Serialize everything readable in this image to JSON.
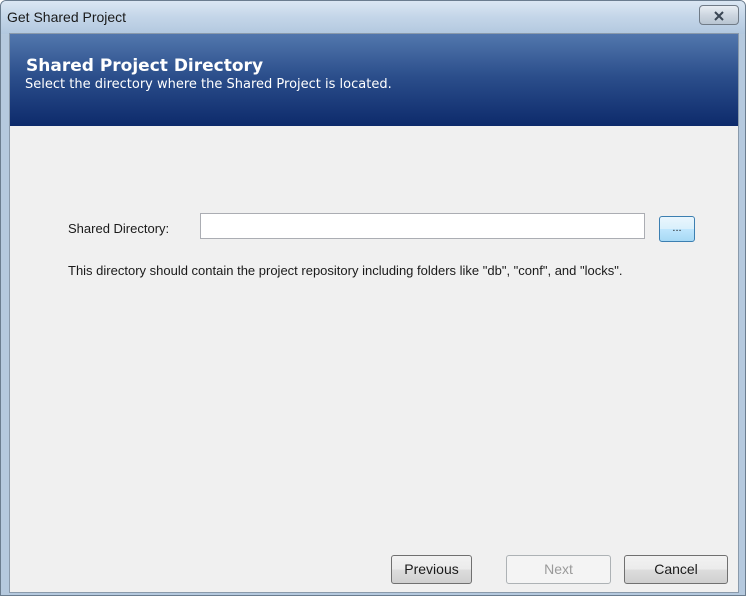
{
  "window": {
    "title": "Get Shared Project",
    "close_glyph": "✕"
  },
  "banner": {
    "title": "Shared Project Directory",
    "subtitle": "Select the directory where the Shared Project is located."
  },
  "form": {
    "label": "Shared Directory:",
    "input_value": "",
    "browse_label": "...",
    "hint": "This directory should contain the project repository including folders like \"db\", \"conf\", and \"locks\"."
  },
  "buttons": {
    "previous": "Previous",
    "next": "Next",
    "cancel": "Cancel"
  },
  "colors": {
    "banner_top": "#5277ad",
    "banner_bottom": "#0d2a6b",
    "content_bg": "#f0f0f0",
    "disabled_text": "#9a9a9a"
  }
}
